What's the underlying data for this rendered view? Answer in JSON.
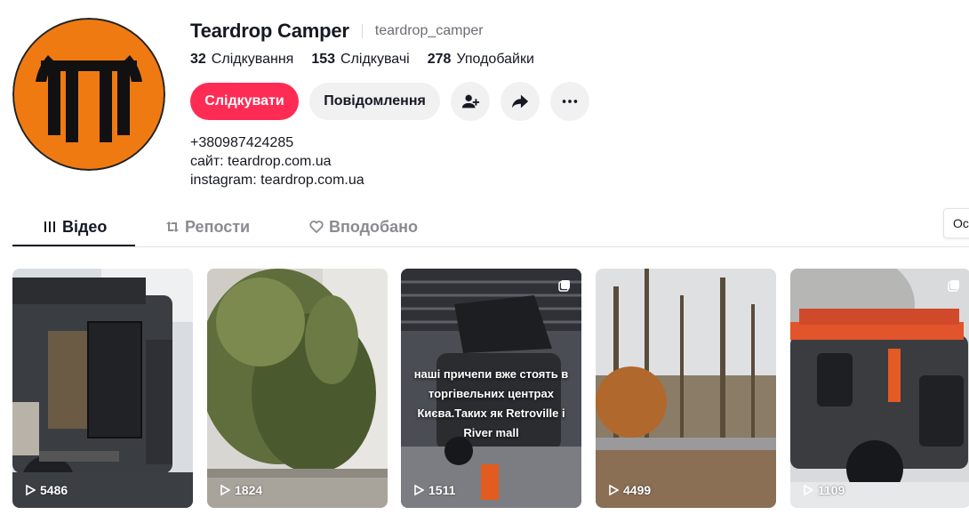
{
  "profile": {
    "display_name": "Teardrop Camper",
    "username": "teardrop_camper",
    "stats": [
      {
        "value": "32",
        "label": "Слідкування"
      },
      {
        "value": "153",
        "label": "Слідкувачі"
      },
      {
        "value": "278",
        "label": "Уподобайки"
      }
    ],
    "follow_label": "Слідкувати",
    "message_label": "Повідомлення",
    "bio_lines": [
      "+380987424285",
      "сайт: teardrop.com.ua",
      "instagram: teardrop.com.ua"
    ],
    "avatar_colors": {
      "outer": "#222222",
      "fill": "#f07a12",
      "mark": "#111111"
    }
  },
  "tabs": [
    {
      "label": "Відео",
      "icon": "grid-icon",
      "active": true
    },
    {
      "label": "Репости",
      "icon": "repost-icon",
      "active": false
    },
    {
      "label": "Вподобано",
      "icon": "heart-icon",
      "active": false
    }
  ],
  "sort_label": "Ост",
  "accent_color": "#fe2c55",
  "videos": [
    {
      "views": "5486",
      "multi": false,
      "overlay": ""
    },
    {
      "views": "1824",
      "multi": false,
      "overlay": ""
    },
    {
      "views": "1511",
      "multi": true,
      "overlay": "наші причепи вже стоять в торгівельних центрах Києва.Таких як Retroville і River mall"
    },
    {
      "views": "4499",
      "multi": false,
      "overlay": ""
    },
    {
      "views": "1109",
      "multi": true,
      "overlay": ""
    }
  ]
}
